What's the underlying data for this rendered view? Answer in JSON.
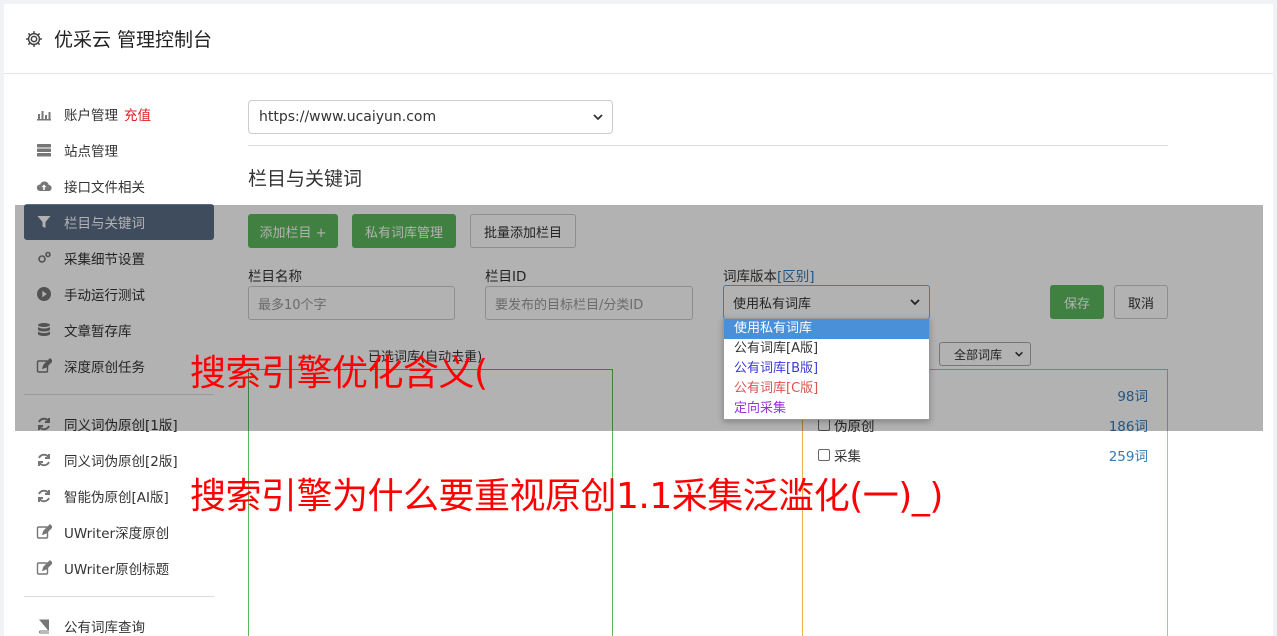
{
  "header": {
    "title": "优采云 管理控制台",
    "icon": "gear-icon"
  },
  "sidebar": {
    "items": [
      {
        "label": "账户管理",
        "badge": "充值",
        "icon": "bar-chart-icon"
      },
      {
        "label": "站点管理",
        "icon": "server-icon"
      },
      {
        "label": "接口文件相关",
        "icon": "cloud-upload-icon"
      },
      {
        "label": "栏目与关键词",
        "icon": "filter-icon",
        "active": true
      },
      {
        "label": "采集细节设置",
        "icon": "cogs-icon"
      },
      {
        "label": "手动运行测试",
        "icon": "play-icon"
      },
      {
        "label": "文章暂存库",
        "icon": "database-icon"
      },
      {
        "label": "深度原创任务",
        "icon": "edit-icon"
      },
      {
        "label": "同义词伪原创[1版]",
        "icon": "refresh-icon"
      },
      {
        "label": "同义词伪原创[2版]",
        "icon": "refresh-icon"
      },
      {
        "label": "智能伪原创[AI版]",
        "icon": "refresh-icon"
      },
      {
        "label": "UWriter深度原创",
        "icon": "edit-icon"
      },
      {
        "label": "UWriter原创标题",
        "icon": "edit-icon"
      },
      {
        "label": "公有词库查询",
        "icon": "book-icon"
      }
    ]
  },
  "main": {
    "site_select": "https://www.ucaiyun.com",
    "section_title": "栏目与关键词",
    "buttons": {
      "add_column": "添加栏目 +",
      "private_lib": "私有词库管理",
      "batch_add": "批量添加栏目",
      "save": "保存",
      "cancel": "取消"
    },
    "fields": {
      "column_name_label": "栏目名称",
      "column_name_placeholder": "最多10个字",
      "column_id_label": "栏目ID",
      "column_id_placeholder": "要发布的目标栏目/分类ID",
      "lib_version_label": "词库版本",
      "lib_version_link": "[区别]",
      "lib_version_value": "使用私有词库"
    },
    "lib_options": [
      {
        "label": "使用私有词库",
        "color": "#ffffff"
      },
      {
        "label": "公有词库[A版]",
        "color": "#333333"
      },
      {
        "label": "公有词库[B版]",
        "color": "#3b3bd6"
      },
      {
        "label": "公有词库[C版]",
        "color": "#d9534f"
      },
      {
        "label": "定向采集",
        "color": "#9b30d9"
      }
    ],
    "selected_lib_title": "已选词库(自动去重)",
    "all_lib": "全部词库",
    "lib_rows": [
      {
        "label": "",
        "count": "98词",
        "checkbox": false
      },
      {
        "label": "伪原创",
        "count": "186词",
        "checkbox": true
      },
      {
        "label": "采集",
        "count": "259词",
        "checkbox": true
      }
    ]
  },
  "watermarks": {
    "line1": "搜索引擎优化含义(",
    "line2": "搜索引擎为什么要重视原创1.1采集泛滥化(一)_)"
  }
}
